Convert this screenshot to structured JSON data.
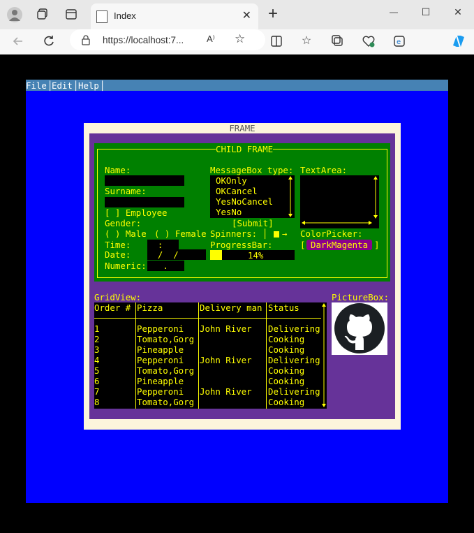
{
  "browser": {
    "tab_title": "Index",
    "tab_close": "✕",
    "new_tab": "+",
    "url": "https://localhost:7...",
    "reader_icon": "A⁾",
    "window_controls": {
      "minimize": "—",
      "maximize": "☐",
      "close": "✕"
    }
  },
  "menu": [
    "File",
    "Edit",
    "Help"
  ],
  "frame": {
    "title": "FRAME",
    "child_title": "CHILD FRAME",
    "name_label": "Name:",
    "surname_label": "Surname:",
    "employee_checkbox": "[ ] Employee",
    "gender_label": "Gender:",
    "gender_options": [
      "( ) Male",
      "( ) Female"
    ],
    "time_label": "Time:",
    "time_value": "  :  ",
    "date_label": "Date:",
    "date_value": "  /  /",
    "numeric_label": "Numeric:",
    "numeric_value": "   .  ",
    "messagebox_label": "MessageBox type:",
    "messagebox_options": [
      "OKOnly",
      "OKCancel",
      "YesNoCancel",
      "YesNo"
    ],
    "submit_button": "[Submit]",
    "spinners_label": "Spinners:",
    "spinner_arrow": "→",
    "progressbar_label": "ProgressBar:",
    "progress_text": "14%",
    "progress_value": 0.14,
    "textarea_label": "TextArea:",
    "colorpicker_label": "ColorPicker:",
    "colorpicker_value": "DarkMagenta",
    "gridview_label": "GridView:",
    "picturebox_label": "PictureBox:",
    "grid_columns": [
      "Order #",
      "Pizza",
      "Delivery man",
      "Status"
    ],
    "grid_rows": [
      [
        "1",
        "Pepperoni",
        "John River",
        "Delivering"
      ],
      [
        "2",
        "Tomato,Gorg",
        "",
        "Cooking"
      ],
      [
        "3",
        "Pineapple",
        "",
        "Cooking"
      ],
      [
        "4",
        "Pepperoni",
        "John River",
        "Delivering"
      ],
      [
        "5",
        "Tomato,Gorg",
        "",
        "Cooking"
      ],
      [
        "6",
        "Pineapple",
        "",
        "Cooking"
      ],
      [
        "7",
        "Pepperoni",
        "John River",
        "Delivering"
      ],
      [
        "8",
        "Tomato,Gorg",
        "",
        "Cooking"
      ]
    ]
  },
  "colors": {
    "screen": "#0000ff",
    "menubar": "#4682b4",
    "frame_bg": "#fcf5dc",
    "frame_body": "#663399",
    "child_frame": "#008000",
    "text": "#ffff00",
    "colorpicker": "#8b008b"
  }
}
